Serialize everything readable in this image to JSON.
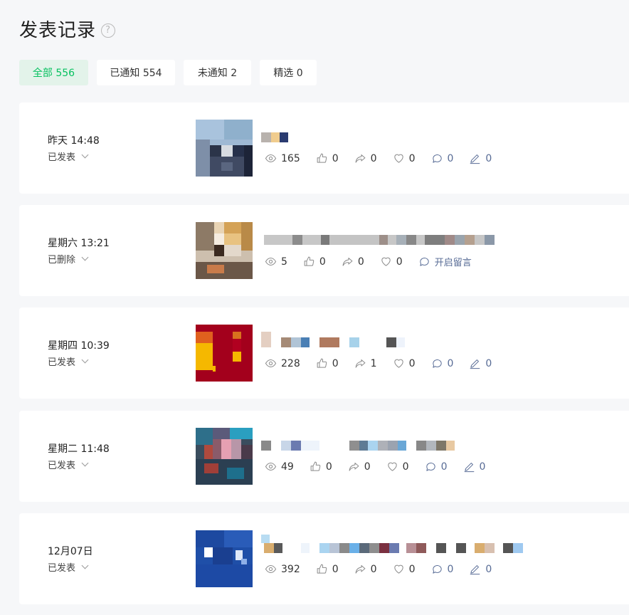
{
  "header": {
    "title": "发表记录",
    "help_icon": "?"
  },
  "tabs": [
    {
      "label": "全部 556",
      "active": true
    },
    {
      "label": "已通知 554"
    },
    {
      "label": "未通知 2"
    },
    {
      "label": "精选 0"
    }
  ],
  "posts": [
    {
      "date": "昨天 14:48",
      "status": "已发表",
      "views": "165",
      "likes": "0",
      "shares": "0",
      "favorites": "0",
      "comments": "0",
      "edits": "0"
    },
    {
      "date": "星期六 13:21",
      "status": "已删除",
      "views": "5",
      "likes": "0",
      "shares": "0",
      "favorites": "0",
      "comment_action": "开启留言"
    },
    {
      "date": "星期四 10:39",
      "status": "已发表",
      "views": "228",
      "likes": "0",
      "shares": "1",
      "favorites": "0",
      "comments": "0",
      "edits": "0"
    },
    {
      "date": "星期二 11:48",
      "status": "已发表",
      "views": "49",
      "likes": "0",
      "shares": "0",
      "favorites": "0",
      "comments": "0",
      "edits": "0"
    },
    {
      "date": "12月07日",
      "status": "已发表",
      "views": "392",
      "likes": "0",
      "shares": "0",
      "favorites": "0",
      "comments": "0",
      "edits": "0"
    }
  ],
  "colors": {
    "accent_green": "#07c160",
    "link_blue": "#576b95",
    "background": "#f6f7f9"
  }
}
